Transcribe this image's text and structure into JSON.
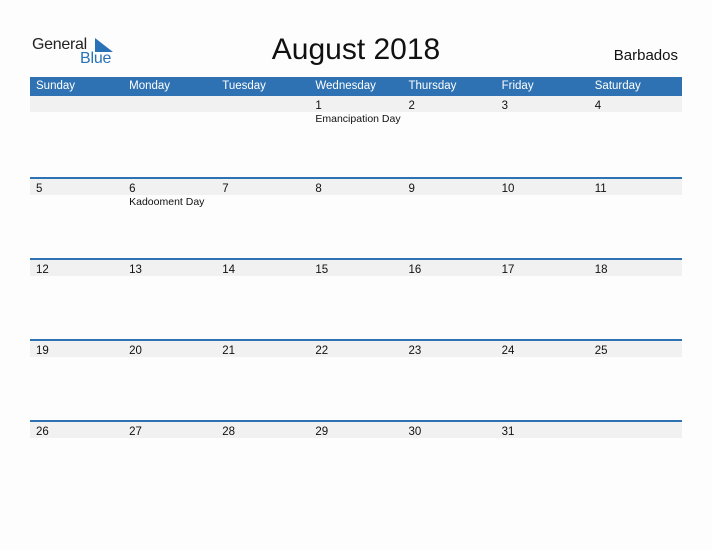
{
  "logo": {
    "general": "General",
    "blue": "Blue",
    "accent": "#2a72b5"
  },
  "title": "August 2018",
  "country": "Barbados",
  "header_color": "#2e72b3",
  "weekdays": [
    "Sunday",
    "Monday",
    "Tuesday",
    "Wednesday",
    "Thursday",
    "Friday",
    "Saturday"
  ],
  "weeks": [
    {
      "days": [
        "",
        "",
        "",
        "1",
        "2",
        "3",
        "4"
      ],
      "events": [
        "",
        "",
        "",
        "Emancipation Day",
        "",
        "",
        ""
      ]
    },
    {
      "days": [
        "5",
        "6",
        "7",
        "8",
        "9",
        "10",
        "11"
      ],
      "events": [
        "",
        "Kadooment Day",
        "",
        "",
        "",
        "",
        ""
      ]
    },
    {
      "days": [
        "12",
        "13",
        "14",
        "15",
        "16",
        "17",
        "18"
      ],
      "events": [
        "",
        "",
        "",
        "",
        "",
        "",
        ""
      ]
    },
    {
      "days": [
        "19",
        "20",
        "21",
        "22",
        "23",
        "24",
        "25"
      ],
      "events": [
        "",
        "",
        "",
        "",
        "",
        "",
        ""
      ]
    },
    {
      "days": [
        "26",
        "27",
        "28",
        "29",
        "30",
        "31",
        ""
      ],
      "events": [
        "",
        "",
        "",
        "",
        "",
        "",
        ""
      ]
    }
  ]
}
